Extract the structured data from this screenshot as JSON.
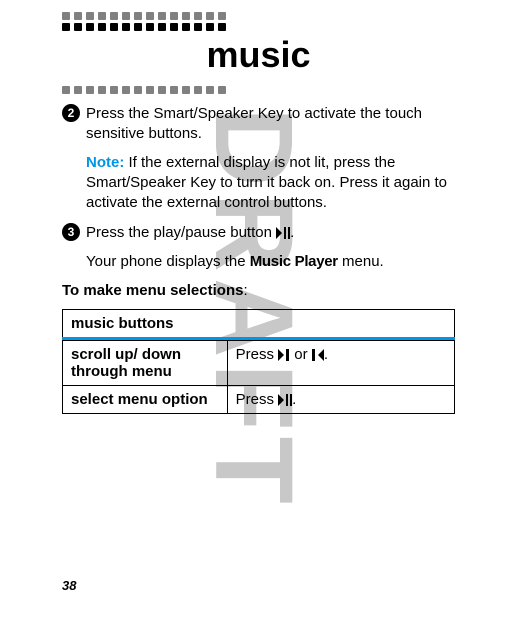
{
  "watermark": "DRAFT",
  "title": "music",
  "steps": [
    {
      "num": "2",
      "body": "Press the Smart/Speaker Key to activate the touch sensitive buttons.",
      "note_label": "Note:",
      "note_body": "If the external display is not lit, press the Smart/Speaker Key to turn it back on. Press it again to activate the external control buttons."
    },
    {
      "num": "3",
      "body_before": "Press the play/pause button ",
      "body_after": ".",
      "follow_before": "Your phone displays the ",
      "follow_bold": "Music Player",
      "follow_after": " menu."
    }
  ],
  "lead_before": "To make menu selections",
  "lead_after": ":",
  "table": {
    "header": "music buttons",
    "rows": [
      {
        "label": "scroll up/ down through menu",
        "action_before": "Press ",
        "action_mid": " or ",
        "action_after": "."
      },
      {
        "label": "select menu option",
        "action_before": "Press ",
        "action_after": "."
      }
    ]
  },
  "page_number": "38",
  "icons": {
    "play_pause": "play-pause-icon",
    "next": "next-track-icon",
    "prev": "prev-track-icon"
  }
}
